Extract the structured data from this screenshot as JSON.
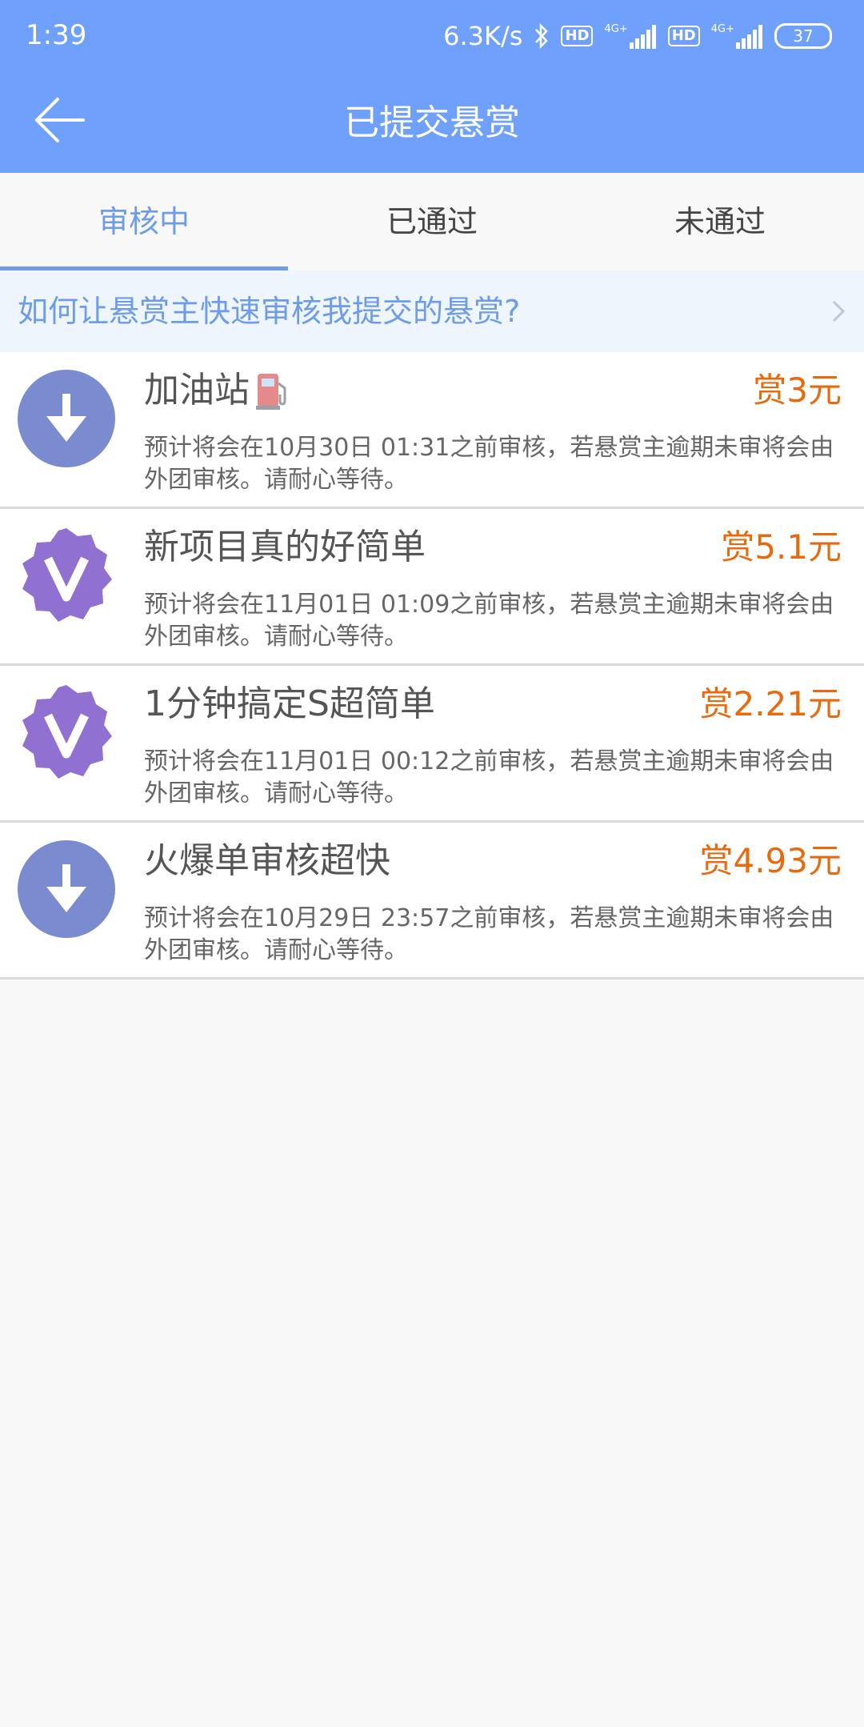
{
  "status_bar": {
    "time": "1:39",
    "network_speed": "6.3K/s",
    "hd_label": "HD",
    "network_type": "4G+",
    "battery": "37",
    "icons": [
      "bluetooth-icon",
      "hd-icon",
      "signal-icon",
      "hd-icon",
      "signal-icon",
      "battery-icon"
    ]
  },
  "header": {
    "title": "已提交悬赏",
    "back_icon": "arrow-left-icon",
    "bg_color": "#6fa0fb"
  },
  "tabs": [
    {
      "label": "审核中",
      "active": true
    },
    {
      "label": "已通过",
      "active": false
    },
    {
      "label": "未通过",
      "active": false
    }
  ],
  "tip": {
    "text": "如何让悬赏主快速审核我提交的悬赏?",
    "icon": "chevron-right-icon"
  },
  "items": [
    {
      "icon": "download-icon",
      "title": "加油站",
      "title_emoji": "fuel-pump-icon",
      "reward": "赏3元",
      "desc": "预计将会在10月30日 01:31之前审核，若悬赏主逾期未审将会由外团审核。请耐心等待。"
    },
    {
      "icon": "v-badge-icon",
      "title": "新项目真的好简单",
      "reward": "赏5.1元",
      "desc": "预计将会在11月01日 01:09之前审核，若悬赏主逾期未审将会由外团审核。请耐心等待。"
    },
    {
      "icon": "v-badge-icon",
      "title": "1分钟搞定S超简单",
      "reward": "赏2.21元",
      "desc": "预计将会在11月01日 00:12之前审核，若悬赏主逾期未审将会由外团审核。请耐心等待。"
    },
    {
      "icon": "download-icon",
      "title": "火爆单审核超快",
      "reward": "赏4.93元",
      "desc": "预计将会在10月29日 23:57之前审核，若悬赏主逾期未审将会由外团审核。请耐心等待。"
    }
  ],
  "colors": {
    "accent": "#6e9ce8",
    "reward": "#e76a0f",
    "download_icon_bg": "#7b8bcf",
    "v_badge_bg": "#9070d0"
  }
}
